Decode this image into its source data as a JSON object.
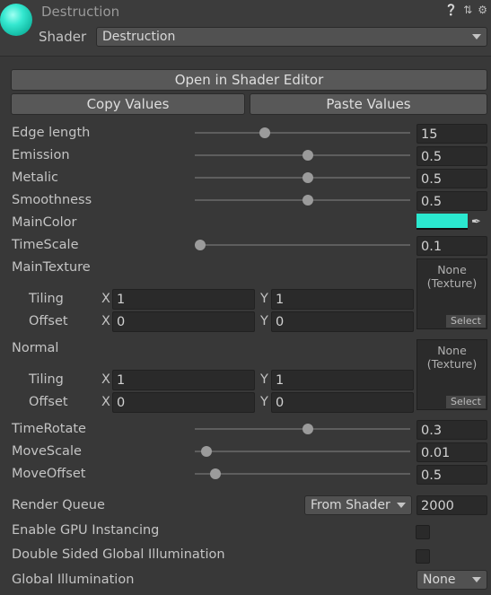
{
  "header": {
    "title": "Destruction",
    "shader_label": "Shader",
    "shader_value": "Destruction",
    "icons": [
      "help-icon",
      "preset-icon",
      "settings-icon"
    ]
  },
  "buttons": {
    "open_editor": "Open in Shader Editor",
    "copy_values": "Copy Values",
    "paste_values": "Paste Values"
  },
  "props": {
    "edge_length": {
      "label": "Edge length",
      "value": "15",
      "level": 0.3
    },
    "emission": {
      "label": "Emission",
      "value": "0.5",
      "level": 0.5
    },
    "metalic": {
      "label": "Metalic",
      "value": "0.5",
      "level": 0.5
    },
    "smoothness": {
      "label": "Smoothness",
      "value": "0.5",
      "level": 0.5
    },
    "main_color": {
      "label": "MainColor",
      "color": "#2be8cf"
    },
    "time_scale": {
      "label": "TimeScale",
      "value": "0.1",
      "level": 0.0
    },
    "main_texture": {
      "label": "MainTexture",
      "none_text": "None",
      "texture_text": "(Texture)",
      "select": "Select",
      "tiling_label": "Tiling",
      "tiling_x": "1",
      "tiling_y": "1",
      "offset_label": "Offset",
      "offset_x": "0",
      "offset_y": "0"
    },
    "normal": {
      "label": "Normal",
      "none_text": "None",
      "texture_text": "(Texture)",
      "select": "Select",
      "tiling_label": "Tiling",
      "tiling_x": "1",
      "tiling_y": "1",
      "offset_label": "Offset",
      "offset_x": "0",
      "offset_y": "0"
    },
    "time_rotate": {
      "label": "TimeRotate",
      "value": "0.3",
      "level": 0.5
    },
    "move_scale": {
      "label": "MoveScale",
      "value": "0.01",
      "level": 0.03
    },
    "move_offset": {
      "label": "MoveOffset",
      "value": "0.5",
      "level": 0.07
    }
  },
  "axis": {
    "x": "X",
    "y": "Y"
  },
  "advanced": {
    "render_queue_label": "Render Queue",
    "render_queue_mode": "From Shader",
    "render_queue_value": "2000",
    "gpu_instancing_label": "Enable GPU Instancing",
    "gpu_instancing_checked": false,
    "double_sided_gi_label": "Double Sided Global Illumination",
    "double_sided_gi_checked": false,
    "global_illumination_label": "Global Illumination",
    "global_illumination_value": "None"
  }
}
